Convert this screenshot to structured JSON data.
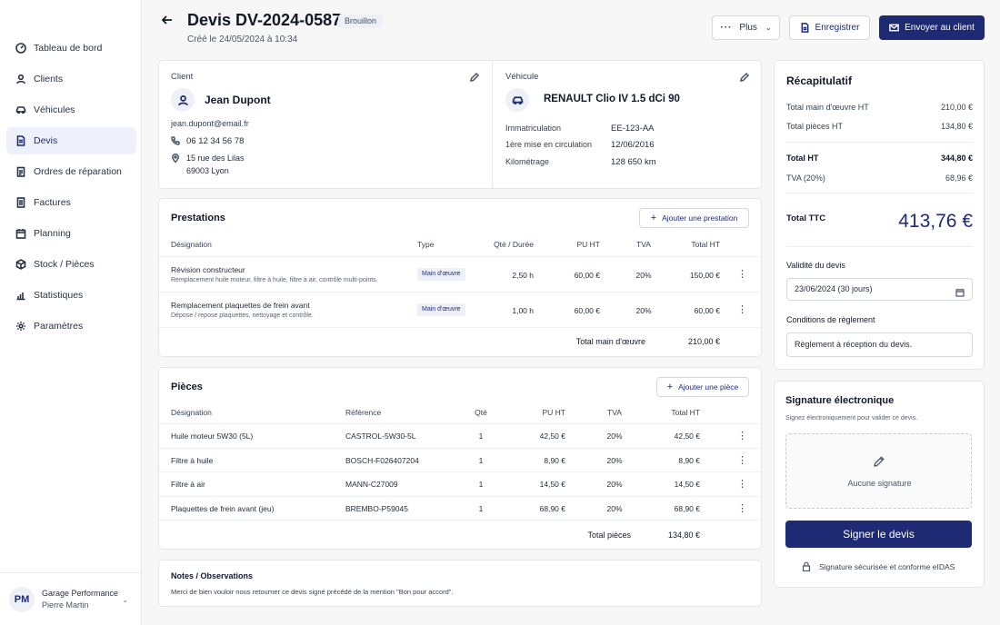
{
  "sidebar": {
    "items": [
      {
        "label": "Tableau de bord",
        "icon": "dashboard-icon"
      },
      {
        "label": "Clients",
        "icon": "user-icon"
      },
      {
        "label": "Véhicules",
        "icon": "car-icon"
      },
      {
        "label": "Devis",
        "icon": "document-icon",
        "active": true
      },
      {
        "label": "Ordres de réparation",
        "icon": "clipboard-icon"
      },
      {
        "label": "Factures",
        "icon": "invoice-icon"
      },
      {
        "label": "Planning",
        "icon": "calendar-icon"
      },
      {
        "label": "Stock / Pièces",
        "icon": "box-icon"
      },
      {
        "label": "Statistiques",
        "icon": "chart-icon"
      },
      {
        "label": "Paramètres",
        "icon": "gear-icon"
      }
    ],
    "user": {
      "initials": "PM",
      "company": "Garage Performance",
      "name": "Pierre Martin"
    }
  },
  "header": {
    "title": "Devis DV-2024-0587",
    "status": "Brouillon",
    "created": "Créé le 24/05/2024 à 10:34",
    "more_label": "Plus",
    "save_label": "Enregistrer",
    "send_label": "Envoyer au client"
  },
  "client": {
    "section_label": "Client",
    "name": "Jean Dupont",
    "email": "jean.dupont@email.fr",
    "phone": "06 12 34 56 78",
    "address_line1": "15 rue des Lilas",
    "address_line2": "69003 Lyon"
  },
  "vehicle": {
    "section_label": "Véhicule",
    "name": "RENAULT Clio IV 1.5 dCi 90",
    "plate_label": "Immatriculation",
    "plate": "EE-123-AA",
    "first_reg_label": "1ère mise en circulation",
    "first_reg": "12/06/2016",
    "mileage_label": "Kilométrage",
    "mileage": "128 650 km"
  },
  "prestations": {
    "title": "Prestations",
    "add_label": "Ajouter une prestation",
    "headers": {
      "designation": "Désignation",
      "type": "Type",
      "qty": "Qté / Durée",
      "pu": "PU HT",
      "tva": "TVA",
      "total": "Total HT"
    },
    "rows": [
      {
        "name": "Révision constructeur",
        "desc": "Remplacement huile moteur, filtre à huile, filtre à air, contrôle multi-points.",
        "type": "Main d'œuvre",
        "qty": "2,50 h",
        "pu": "60,00 €",
        "tva": "20%",
        "total": "150,00 €"
      },
      {
        "name": "Remplacement plaquettes de frein avant",
        "desc": "Dépose / repose plaquettes, nettoyage et contrôle.",
        "type": "Main d'œuvre",
        "qty": "1,00 h",
        "pu": "60,00 €",
        "tva": "20%",
        "total": "60,00 €"
      }
    ],
    "total_label": "Total main d'œuvre",
    "total_value": "210,00 €"
  },
  "pieces": {
    "title": "Pièces",
    "add_label": "Ajouter une pièce",
    "headers": {
      "designation": "Désignation",
      "ref": "Référence",
      "qty": "Qté",
      "pu": "PU HT",
      "tva": "TVA",
      "total": "Total HT"
    },
    "rows": [
      {
        "name": "Huile moteur 5W30 (5L)",
        "ref": "CASTROL-5W30-5L",
        "qty": "1",
        "pu": "42,50 €",
        "tva": "20%",
        "total": "42,50 €"
      },
      {
        "name": "Filtre à huile",
        "ref": "BOSCH-F026407204",
        "qty": "1",
        "pu": "8,90 €",
        "tva": "20%",
        "total": "8,90 €"
      },
      {
        "name": "Filtre à air",
        "ref": "MANN-C27009",
        "qty": "1",
        "pu": "14,50 €",
        "tva": "20%",
        "total": "14,50 €"
      },
      {
        "name": "Plaquettes de frein avant (jeu)",
        "ref": "BREMBO-P59045",
        "qty": "1",
        "pu": "68,90 €",
        "tva": "20%",
        "total": "68,90 €"
      }
    ],
    "total_label": "Total pièces",
    "total_value": "134,80 €"
  },
  "notes": {
    "title": "Notes / Observations",
    "text": "Merci de bien vouloir nous retourner ce devis signé précédé de la mention \"Bon pour accord\"."
  },
  "summary": {
    "title": "Récapitulatif",
    "labor_label": "Total main d'œuvre HT",
    "labor": "210,00 €",
    "parts_label": "Total pièces HT",
    "parts": "134,80 €",
    "ht_label": "Total HT",
    "ht": "344,80 €",
    "tva_label": "TVA (20%)",
    "tva": "68,96 €",
    "ttc_label": "Total TTC",
    "ttc": "413,76 €",
    "validity_label": "Validité du devis",
    "validity_value": "23/06/2024 (30 jours)",
    "payment_label": "Conditions de règlement",
    "payment_value": "Règlement à réception du devis."
  },
  "signature": {
    "title": "Signature électronique",
    "subtitle": "Signez électroniquement pour valider ce devis.",
    "empty": "Aucune signature",
    "button": "Signer le devis",
    "secure": "Signature sécurisée et conforme eIDAS"
  },
  "colors": {
    "primary": "#1f2a74",
    "accent": "#1e2a78",
    "active_bg": "#eef1fb"
  }
}
